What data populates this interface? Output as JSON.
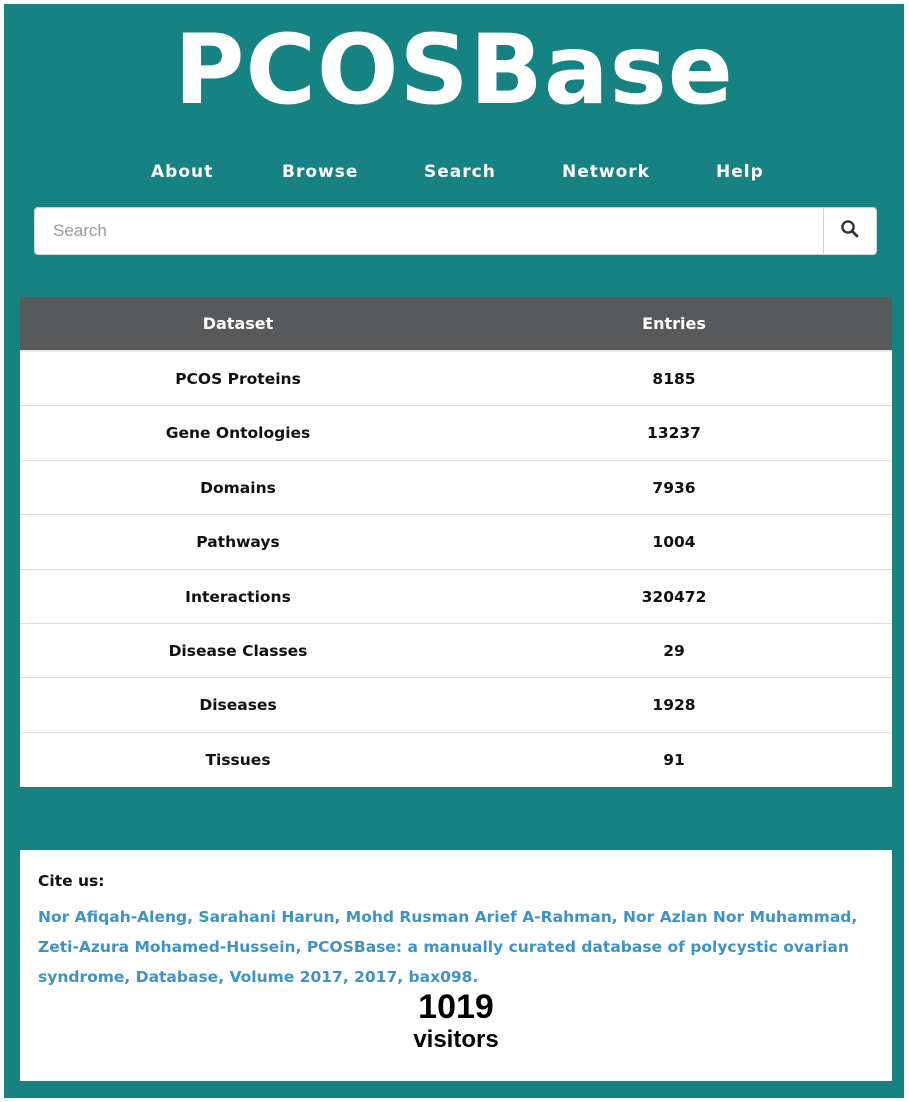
{
  "header": {
    "brand": "PCOSBase"
  },
  "nav": {
    "items": [
      {
        "label": "About"
      },
      {
        "label": "Browse"
      },
      {
        "label": "Search"
      },
      {
        "label": "Network"
      },
      {
        "label": "Help"
      }
    ]
  },
  "search": {
    "placeholder": "Search",
    "value": "",
    "button_icon": "search-icon"
  },
  "table": {
    "headers": {
      "dataset": "Dataset",
      "entries": "Entries"
    },
    "rows": [
      {
        "dataset": "PCOS Proteins",
        "entries": "8185"
      },
      {
        "dataset": "Gene Ontologies",
        "entries": "13237"
      },
      {
        "dataset": "Domains",
        "entries": "7936"
      },
      {
        "dataset": "Pathways",
        "entries": "1004"
      },
      {
        "dataset": "Interactions",
        "entries": "320472"
      },
      {
        "dataset": "Disease Classes",
        "entries": "29"
      },
      {
        "dataset": "Diseases",
        "entries": "1928"
      },
      {
        "dataset": "Tissues",
        "entries": "91"
      }
    ]
  },
  "cite": {
    "label": "Cite us:",
    "text": "Nor Afiqah-Aleng, Sarahani Harun, Mohd Rusman Arief A-Rahman, Nor Azlan Nor Muhammad, Zeti-Azura Mohamed-Hussein, PCOSBase: a manually curated database of polycystic ovarian syndrome, Database, Volume 2017, 2017, bax098."
  },
  "counter": {
    "count": "1019",
    "label": "visitors"
  },
  "colors": {
    "background": "#178282",
    "table_header": "#58595b",
    "link": "#3d93c9"
  }
}
